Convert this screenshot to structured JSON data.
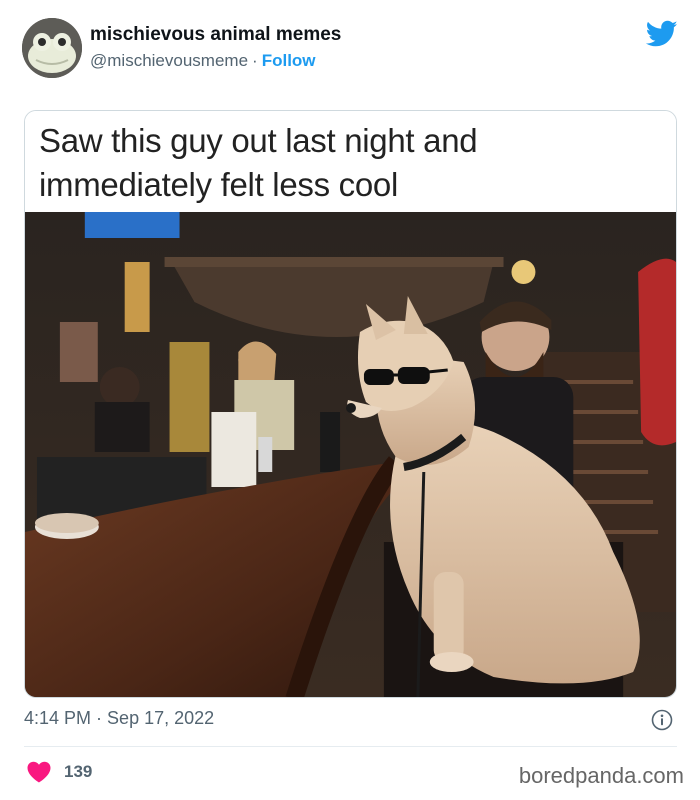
{
  "author": {
    "display_name": "mischievous animal memes",
    "handle": "@mischievousmeme",
    "separator": "·",
    "follow_label": "Follow",
    "avatar_icon": "frog-avatar-icon"
  },
  "platform": {
    "icon": "twitter-bird-icon",
    "accent": "#1d9bf0"
  },
  "meme": {
    "caption_lines": [
      "Saw this guy out last night and",
      "immediately felt less cool"
    ],
    "photo_description_icon": "dog-in-sunglasses-at-bar-photo"
  },
  "meta": {
    "time": "4:14 PM",
    "separator": "·",
    "date": "Sep 17, 2022",
    "info_icon": "info-icon"
  },
  "engagement": {
    "likes": "139",
    "heart_icon": "heart-icon",
    "heart_color": "#f91880"
  },
  "watermark": "boredpanda.com"
}
